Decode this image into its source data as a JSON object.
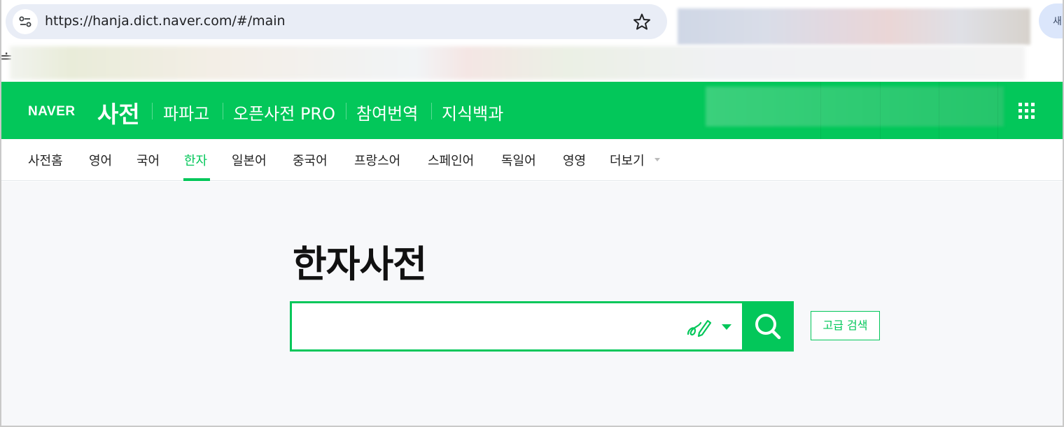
{
  "browser": {
    "url": "https://hanja.dict.naver.com/#/main",
    "new_tab_label": "새",
    "bookmark_glyph": "≐",
    "icons": [
      "site-info-icon",
      "star-icon"
    ]
  },
  "header": {
    "logo": "NAVER",
    "service": "사전",
    "links": [
      "파파고",
      "오픈사전 PRO",
      "참여번역",
      "지식백과"
    ],
    "brand_color": "#03c75a",
    "icons": [
      "apps-grid-icon"
    ]
  },
  "lnb": {
    "items": [
      "사전홈",
      "영어",
      "국어",
      "한자",
      "일본어",
      "중국어",
      "프랑스어",
      "스페인어",
      "독일어",
      "영영",
      "더보기"
    ],
    "active": "한자"
  },
  "main": {
    "title": "한자사전",
    "search": {
      "value": "",
      "placeholder": "",
      "icons": [
        "handwriting-pen-icon",
        "dropdown-arrow-icon",
        "search-icon"
      ]
    },
    "advanced_search_label": "고급 검색"
  }
}
